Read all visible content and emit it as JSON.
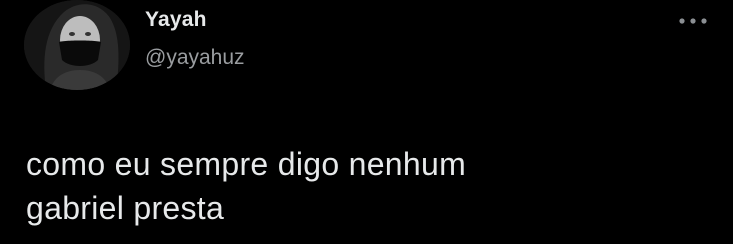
{
  "user": {
    "display_name": "Yayah",
    "handle": "@yayahuz",
    "avatar_icon": "profile-photo-masked-person"
  },
  "menu": {
    "icon": "more-options-icon"
  },
  "tweet": {
    "text": "como eu sempre digo nenhum\ngabriel presta"
  },
  "colors": {
    "background": "#000000",
    "primary_text": "#e7e9ea",
    "secondary_text": "#9a9da0"
  }
}
